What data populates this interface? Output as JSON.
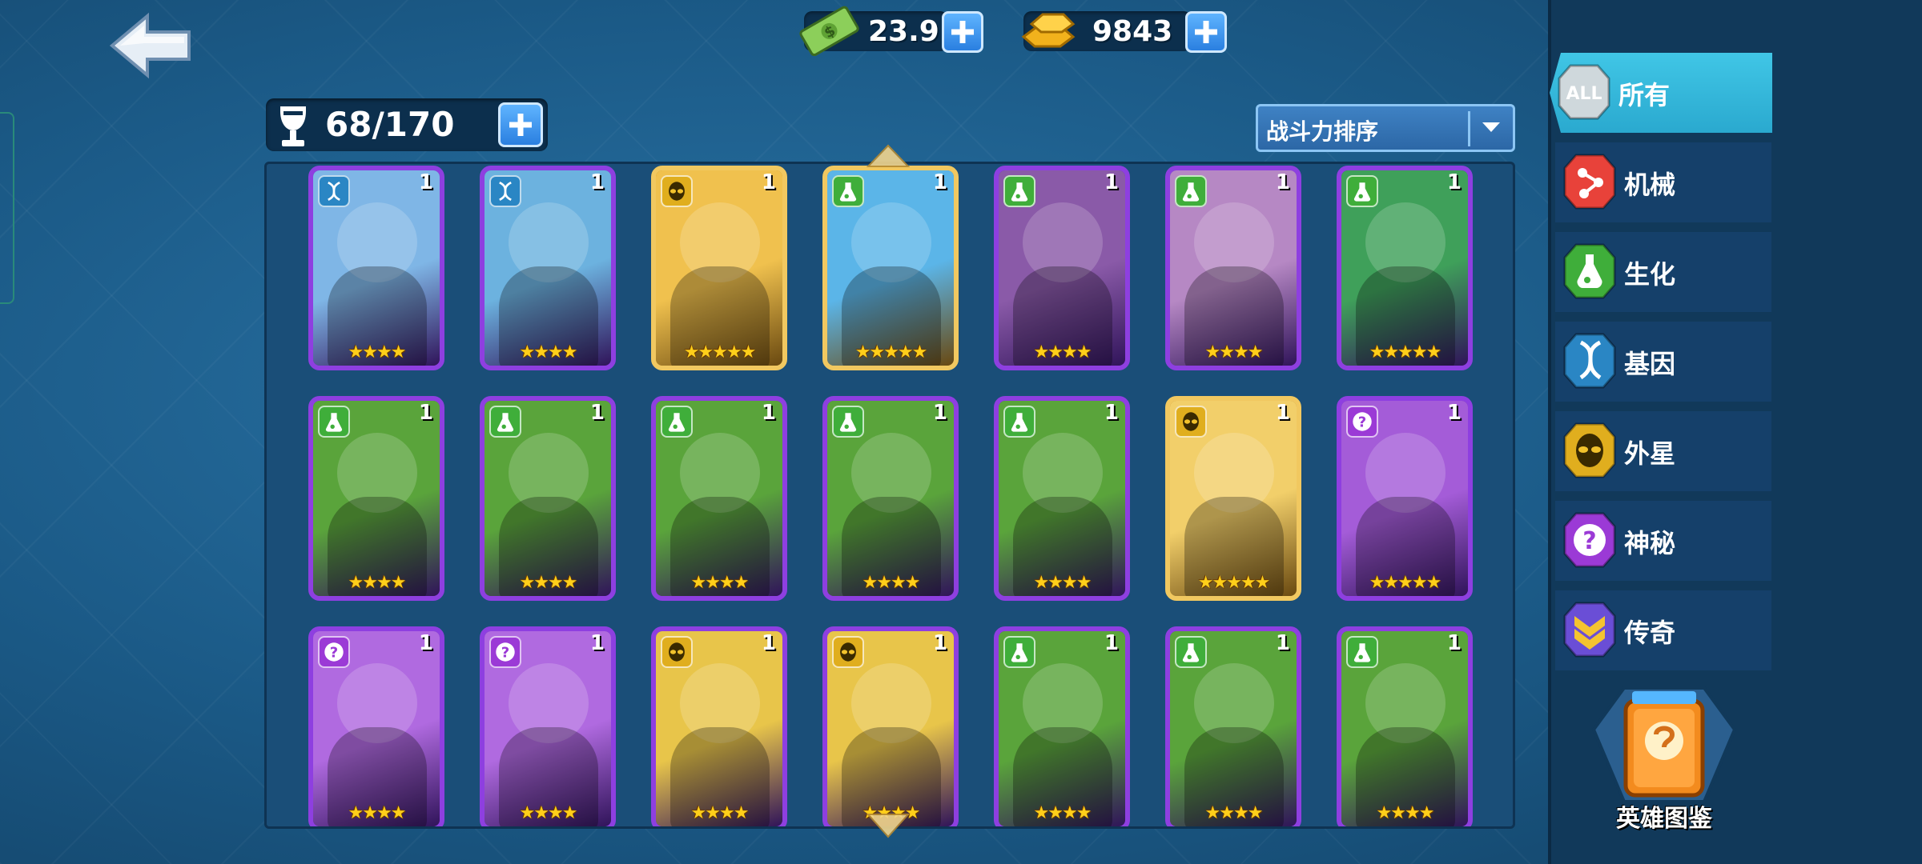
{
  "header": {
    "cash": "23.9M",
    "gold": "9843",
    "capacity": "68/170"
  },
  "sort": {
    "selected": "战斗力排序"
  },
  "categories": [
    {
      "label": "所有",
      "icon": "all-icon",
      "badge": "ALL",
      "active": true
    },
    {
      "label": "机械",
      "icon": "mech-icon",
      "active": false
    },
    {
      "label": "生化",
      "icon": "biochem-icon",
      "active": false
    },
    {
      "label": "基因",
      "icon": "dna-icon",
      "active": false
    },
    {
      "label": "外星",
      "icon": "alien-icon",
      "active": false
    },
    {
      "label": "神秘",
      "icon": "mystery-icon",
      "active": false
    },
    {
      "label": "传奇",
      "icon": "legend-icon",
      "active": false
    }
  ],
  "codex": {
    "label": "英雄图鉴"
  },
  "cards": [
    {
      "level": "1",
      "stars": "★★★★",
      "rarity": "epic",
      "type": "dna",
      "color": "#7fb6e6"
    },
    {
      "level": "1",
      "stars": "★★★★",
      "rarity": "epic",
      "type": "dna",
      "color": "#6cb2df"
    },
    {
      "level": "1",
      "stars": "★★★★★",
      "rarity": "leg",
      "type": "alien",
      "color": "#f0c14e"
    },
    {
      "level": "1",
      "stars": "★★★★★",
      "rarity": "leg",
      "type": "biochem",
      "color": "#5bb5e8"
    },
    {
      "level": "1",
      "stars": "★★★★",
      "rarity": "epic",
      "type": "biochem",
      "color": "#8a5aa8"
    },
    {
      "level": "1",
      "stars": "★★★★",
      "rarity": "epic",
      "type": "biochem",
      "color": "#b688c4"
    },
    {
      "level": "1",
      "stars": "★★★★★",
      "rarity": "epic",
      "type": "biochem",
      "color": "#3fa05a"
    },
    {
      "level": "1",
      "stars": "★★★★",
      "rarity": "epic",
      "type": "biochem",
      "color": "#5aa43b"
    },
    {
      "level": "1",
      "stars": "★★★★",
      "rarity": "epic",
      "type": "biochem",
      "color": "#5aa43b"
    },
    {
      "level": "1",
      "stars": "★★★★",
      "rarity": "epic",
      "type": "biochem",
      "color": "#5aa43b"
    },
    {
      "level": "1",
      "stars": "★★★★",
      "rarity": "epic",
      "type": "biochem",
      "color": "#5aa43b"
    },
    {
      "level": "1",
      "stars": "★★★★",
      "rarity": "epic",
      "type": "biochem",
      "color": "#5aa43b"
    },
    {
      "level": "1",
      "stars": "★★★★★",
      "rarity": "leg",
      "type": "alien",
      "color": "#f2cf6a"
    },
    {
      "level": "1",
      "stars": "★★★★★",
      "rarity": "epic",
      "type": "mystery",
      "color": "#a45cd8"
    },
    {
      "level": "1",
      "stars": "★★★★",
      "rarity": "epic",
      "type": "mystery",
      "color": "#b06ae0"
    },
    {
      "level": "1",
      "stars": "★★★★",
      "rarity": "epic",
      "type": "mystery",
      "color": "#b06ae0"
    },
    {
      "level": "1",
      "stars": "★★★★",
      "rarity": "epic",
      "type": "alien",
      "color": "#e8c54a"
    },
    {
      "level": "1",
      "stars": "★★★★",
      "rarity": "epic",
      "type": "alien",
      "color": "#e8c54a"
    },
    {
      "level": "1",
      "stars": "★★★★",
      "rarity": "epic",
      "type": "biochem",
      "color": "#5aa43b"
    },
    {
      "level": "1",
      "stars": "★★★★",
      "rarity": "epic",
      "type": "biochem",
      "color": "#5aa43b"
    },
    {
      "level": "1",
      "stars": "★★★★",
      "rarity": "epic",
      "type": "biochem",
      "color": "#5aa43b"
    }
  ],
  "colors": {
    "mech": "#e8423a",
    "biochem": "#3fae3a",
    "dna": "#2a86c4",
    "alien": "#e0ae1e",
    "mystery": "#9b3ad6",
    "legend": "#6a4ed6"
  }
}
